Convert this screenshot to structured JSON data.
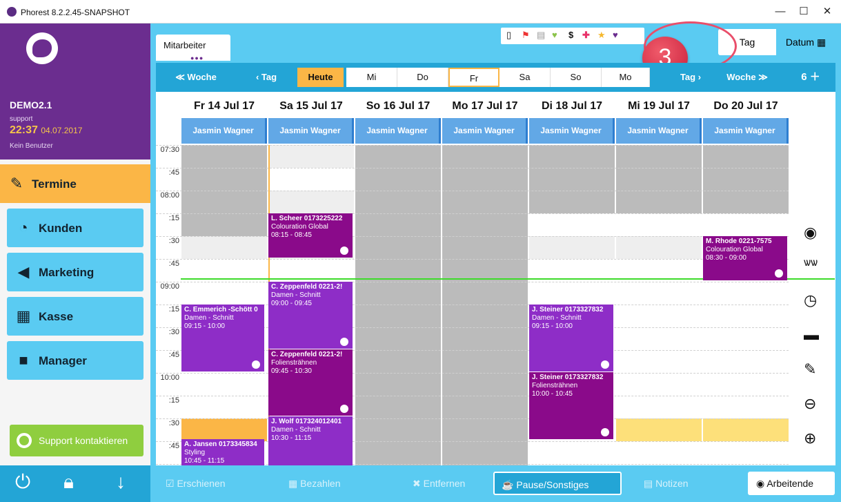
{
  "window": {
    "title": "Phorest 8.2.2.45-SNAPSHOT",
    "minimize": "—",
    "maximize": "☐",
    "close": "✕"
  },
  "sidebar": {
    "user": "DEMO2.1",
    "role": "support",
    "time": "22:37",
    "date": "04.07.2017",
    "no_user": "Kein Benutzer",
    "nav": [
      {
        "label": "Termine",
        "icon": "calendar-edit-icon",
        "active": true
      },
      {
        "label": "Kunden",
        "icon": "head-profile-icon"
      },
      {
        "label": "Marketing",
        "icon": "megaphone-icon"
      },
      {
        "label": "Kasse",
        "icon": "cart-icon"
      },
      {
        "label": "Manager",
        "icon": "briefcase-icon"
      }
    ],
    "support_label": "Support kontaktieren"
  },
  "tabs": {
    "staff_tab": "Mitarbeiter",
    "view_day": "Tag",
    "view_date": "Datum"
  },
  "callout_number": "3",
  "navbar": {
    "prev_week": "Woche",
    "prev_day": "Tag",
    "today": "Heute",
    "days": [
      "Mi",
      "Do",
      "Fr",
      "Sa",
      "So",
      "Mo"
    ],
    "next_day": "Tag",
    "next_week": "Woche",
    "count": "6"
  },
  "calendar": {
    "days": [
      {
        "header": "Fr 14 Jul 17",
        "staff": "Jasmin Wagner"
      },
      {
        "header": "Sa 15 Jul 17",
        "staff": "Jasmin Wagner"
      },
      {
        "header": "So 16 Jul 17",
        "staff": "Jasmin Wagner"
      },
      {
        "header": "Mo 17 Jul 17",
        "staff": "Jasmin Wagner"
      },
      {
        "header": "Di 18 Jul 17",
        "staff": "Jasmin Wagner"
      },
      {
        "header": "Mi 19 Jul 17",
        "staff": "Jasmin Wagner"
      },
      {
        "header": "Do 20 Jul 17",
        "staff": "Jasmin Wagner"
      }
    ],
    "times": [
      "07:30",
      ":45",
      "08:00",
      ":15",
      ":30",
      ":45",
      "09:00",
      ":15",
      ":30",
      ":45",
      "10:00",
      ":15",
      ":30",
      ":45"
    ],
    "appointments": [
      {
        "name": "L. Scheer 0173225222",
        "service": "Colouration Global",
        "time": "08:15 - 08:45"
      },
      {
        "name": "C. Zeppenfeld 0221-2!",
        "service": "Damen - Schnitt",
        "time": "09:00 - 09:45"
      },
      {
        "name": "C. Zeppenfeld 0221-2!",
        "service": "Foliensträhnen",
        "time": "09:45 - 10:30"
      },
      {
        "name": "J. Wolf 017324012401",
        "service": "Damen - Schnitt",
        "time": "10:30 - 11:15"
      },
      {
        "name": "C. Emmerich -Schött 0",
        "service": "Damen - Schnitt",
        "time": "09:15 - 10:00"
      },
      {
        "name": "A. Jansen 0173345834",
        "service": "Styling",
        "time": "10:45 - 11:15"
      },
      {
        "name": "J. Steiner 0173327832",
        "service": "Damen - Schnitt",
        "time": "09:15 - 10:00"
      },
      {
        "name": "J. Steiner 0173327832",
        "service": "Foliensträhnen",
        "time": "10:00 - 10:45"
      },
      {
        "name": "M. Rhode 0221-7575",
        "service": "Colouration Global",
        "time": "08:30 - 09:00"
      }
    ]
  },
  "actions": {
    "erschienen": "Erschienen",
    "bezahlen": "Bezahlen",
    "entfernen": "Entfernen",
    "pause": "Pause/Sonstiges",
    "notizen": "Notizen",
    "arbeitende": "Arbeitende"
  },
  "colors": {
    "purple": "#6b2d8f",
    "cyan": "#5acbf2",
    "orange": "#fbb646",
    "appt": "#8e2dc7",
    "appt_dark": "#8a0a8a"
  }
}
